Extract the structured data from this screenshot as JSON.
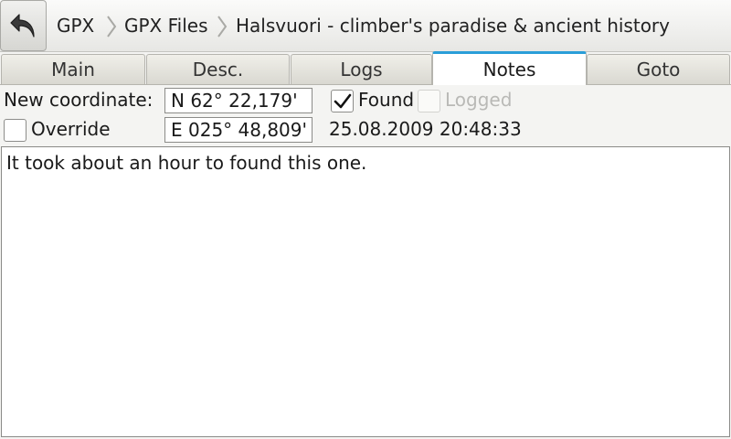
{
  "breadcrumb": {
    "back_icon": "back-arrow-icon",
    "items": [
      {
        "label": "GPX"
      },
      {
        "label": "GPX Files"
      },
      {
        "label": "Halsvuori - climber's paradise & ancient history"
      }
    ]
  },
  "tabs": [
    {
      "label": "Main",
      "active": false
    },
    {
      "label": "Desc.",
      "active": false
    },
    {
      "label": "Logs",
      "active": false
    },
    {
      "label": "Notes",
      "active": true
    },
    {
      "label": "Goto",
      "active": false
    }
  ],
  "notes_form": {
    "new_coordinate_label": "New coordinate:",
    "latitude": "N 62° 22,179'",
    "longitude": "E 025° 48,809'",
    "override_label": "Override",
    "override_checked": false,
    "found_label": "Found",
    "found_checked": true,
    "logged_label": "Logged",
    "logged_checked": false,
    "logged_enabled": false,
    "timestamp": "25.08.2009 20:48:33",
    "note_text": "It took about an hour to found this one."
  },
  "colors": {
    "active_tab_accent": "#2a9ed8",
    "disabled_text": "#b9b9b6"
  }
}
